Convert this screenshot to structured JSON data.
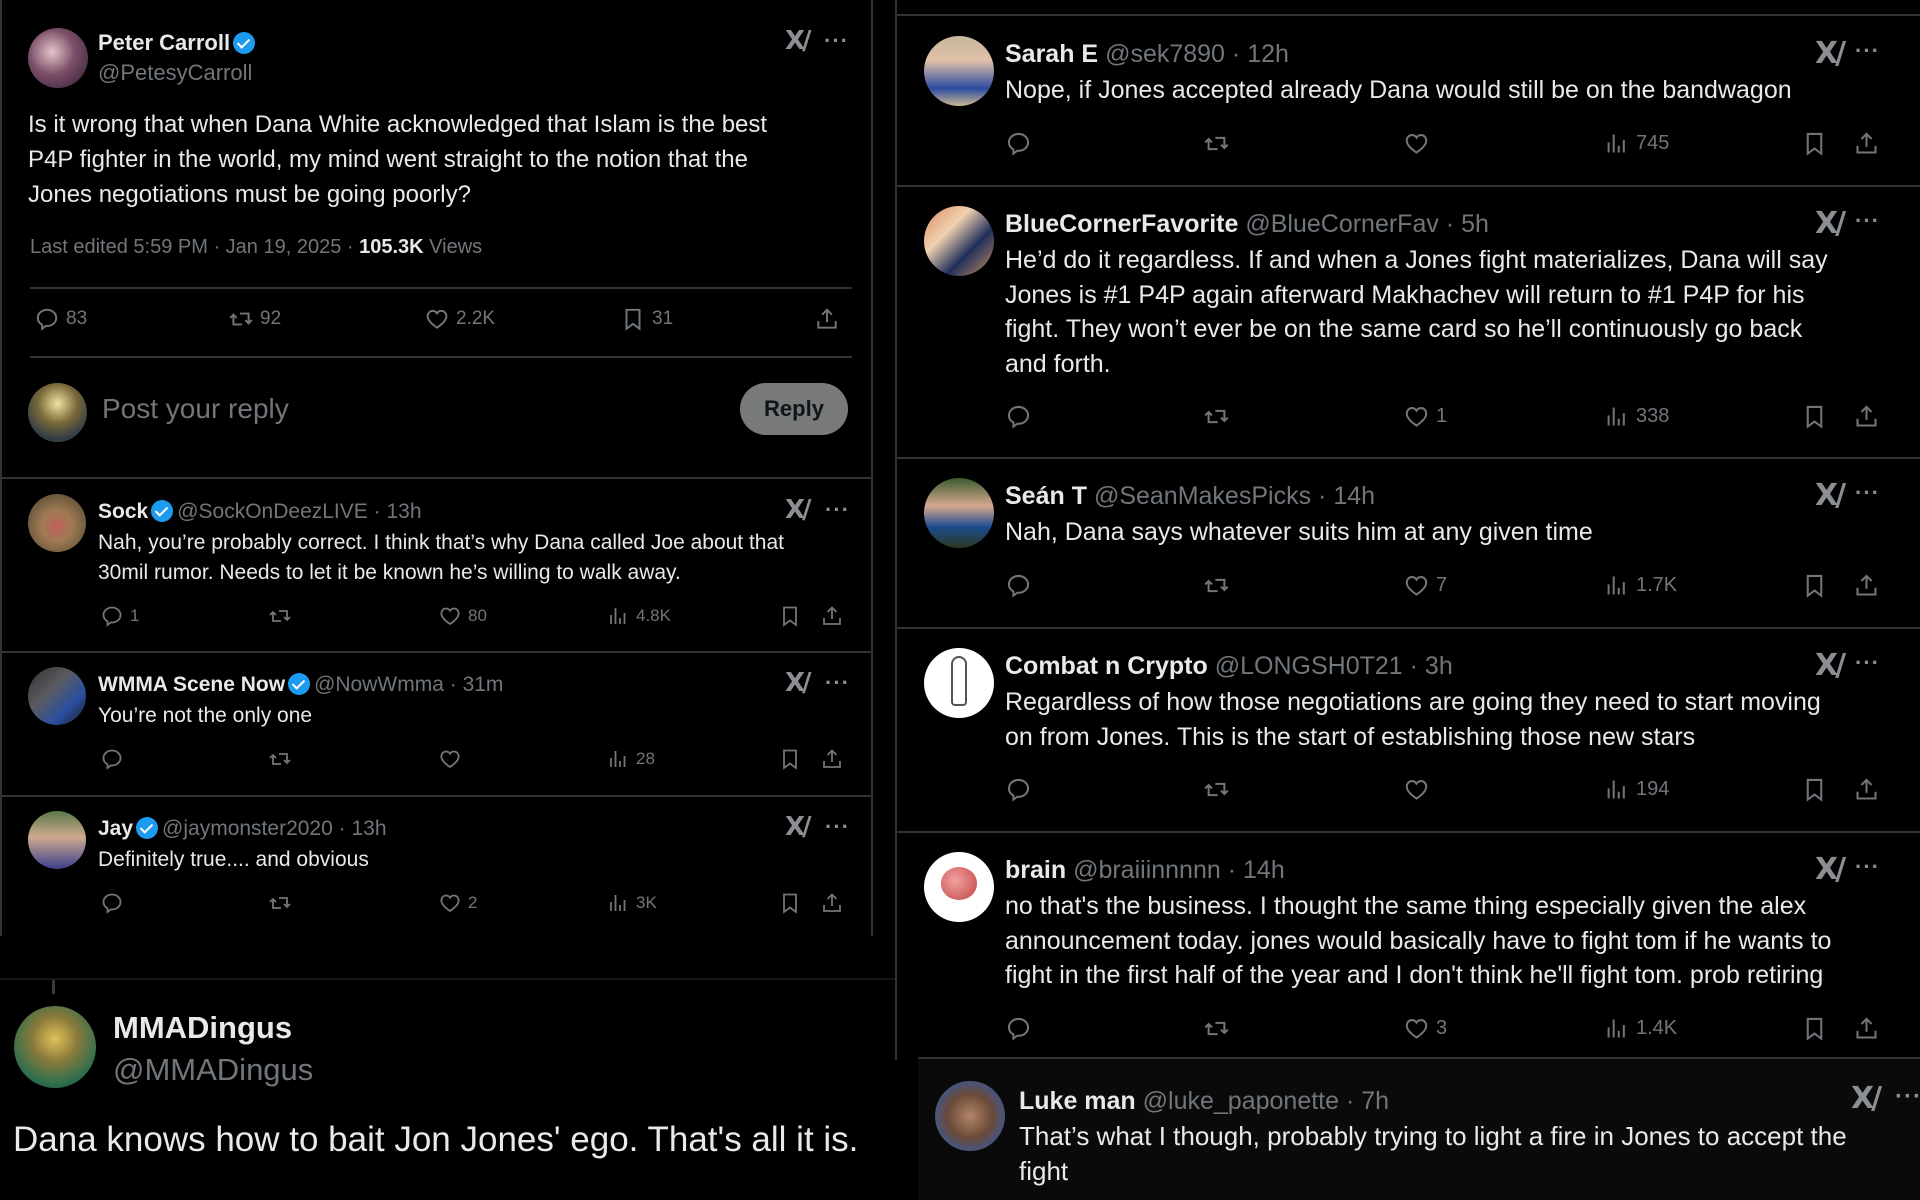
{
  "main_post": {
    "author_name": "Peter Carroll",
    "verified": true,
    "handle": "@PetesyCarroll",
    "text": "Is it wrong that when Dana White acknowledged that Islam is the best P4P fighter in the world, my mind went straight to the notion that the Jones negotiations must be going poorly?",
    "text_lines": [
      "Is it wrong that when Dana White acknowledged that Islam is the best",
      "P4P fighter in the world, my mind went straight to the notion that the",
      "Jones negotiations must be going poorly?"
    ],
    "edited_label": "Last edited 5:59 PM · Jan 19, 2025 · ",
    "views_count": "105.3K",
    "views_label": "Views",
    "stats": {
      "replies": "83",
      "reposts": "92",
      "likes": "2.2K",
      "bookmarks": "31"
    }
  },
  "composer": {
    "placeholder": "Post your reply",
    "reply_button": "Reply"
  },
  "icons": {
    "grok": "grok-icon",
    "more": "more-icon",
    "reply": "reply-icon",
    "repost": "repost-icon",
    "like": "heart-icon",
    "views": "views-icon",
    "bookmark": "bookmark-icon",
    "share": "share-icon",
    "verified": "verified-badge-icon"
  },
  "glyphs": {
    "grok": "X/",
    "more": "···"
  },
  "left_replies": [
    {
      "name": "Sock",
      "verified": true,
      "handle": "@SockOnDeezLIVE",
      "time": "13h",
      "text_lines": [
        "Nah, you’re probably correct. I think that’s why Dana called Joe about that",
        "30mil rumor. Needs to let it be known he’s willing to walk away."
      ],
      "replies": "1",
      "reposts": "",
      "likes": "80",
      "views": "4.8K"
    },
    {
      "name": "WMMA Scene Now",
      "verified": true,
      "handle": "@NowWmma",
      "time": "31m",
      "text_lines": [
        "You’re not the only one"
      ],
      "replies": "",
      "reposts": "",
      "likes": "",
      "views": "28"
    },
    {
      "name": "Jay",
      "verified": true,
      "handle": "@jaymonster2020",
      "time": "13h",
      "text_lines": [
        "Definitely true.... and obvious"
      ],
      "replies": "",
      "reposts": "",
      "likes": "2",
      "views": "3K"
    }
  ],
  "quoted_post": {
    "name": "MMADingus",
    "handle": "@MMADingus",
    "text": "Dana knows how to bait Jon Jones' ego. That's all it is."
  },
  "right_replies": [
    {
      "name": "Sarah E",
      "verified": false,
      "handle": "@sek7890",
      "time": "12h",
      "text_lines": [
        "Nope, if Jones accepted already Dana would still be on the bandwagon"
      ],
      "replies": "",
      "reposts": "",
      "likes": "",
      "views": "745"
    },
    {
      "name": "BlueCornerFavorite",
      "verified": false,
      "handle": "@BlueCornerFav",
      "time": "5h",
      "text_lines": [
        "He’d do it regardless. If and when a Jones fight materializes, Dana will say",
        "Jones is #1 P4P again afterward Makhachev will return to #1 P4P for his",
        "fight. They won’t ever be on the same card so he’ll continuously go back",
        "and forth."
      ],
      "replies": "",
      "reposts": "",
      "likes": "1",
      "views": "338"
    },
    {
      "name": "Seán T",
      "verified": false,
      "handle": "@SeanMakesPicks",
      "time": "14h",
      "text_lines": [
        "Nah, Dana says whatever suits him at any given time"
      ],
      "replies": "",
      "reposts": "",
      "likes": "7",
      "views": "1.7K"
    },
    {
      "name": "Combat n Crypto",
      "verified": false,
      "handle": "@LONGSH0T21",
      "time": "3h",
      "text_lines": [
        "Regardless of how those negotiations are going they need to start moving",
        "on from Jones. This is the start of establishing those new stars"
      ],
      "replies": "",
      "reposts": "",
      "likes": "",
      "views": "194"
    },
    {
      "name": "brain",
      "verified": false,
      "handle": "@braiiinnnnn",
      "time": "14h",
      "text_lines": [
        "no that's the business. I thought the same thing especially given the alex",
        "announcement today. jones would basically have to fight tom if he wants to",
        "fight in the first half of the year and I don't think he'll fight tom. prob retiring"
      ],
      "replies": "",
      "reposts": "",
      "likes": "3",
      "views": "1.4K"
    },
    {
      "name": "Luke man",
      "verified": false,
      "handle": "@luke_paponette",
      "time": "7h",
      "text_lines": [
        "That’s what I though, probably trying to light a fire in Jones to accept the",
        "fight"
      ]
    }
  ],
  "colors": {
    "background": "#000000",
    "text_primary": "#e7e9ea",
    "text_secondary": "#71767b",
    "divider": "#2f3336",
    "verified_blue": "#1d9bf0",
    "reply_button_bg": "#787a7a"
  }
}
